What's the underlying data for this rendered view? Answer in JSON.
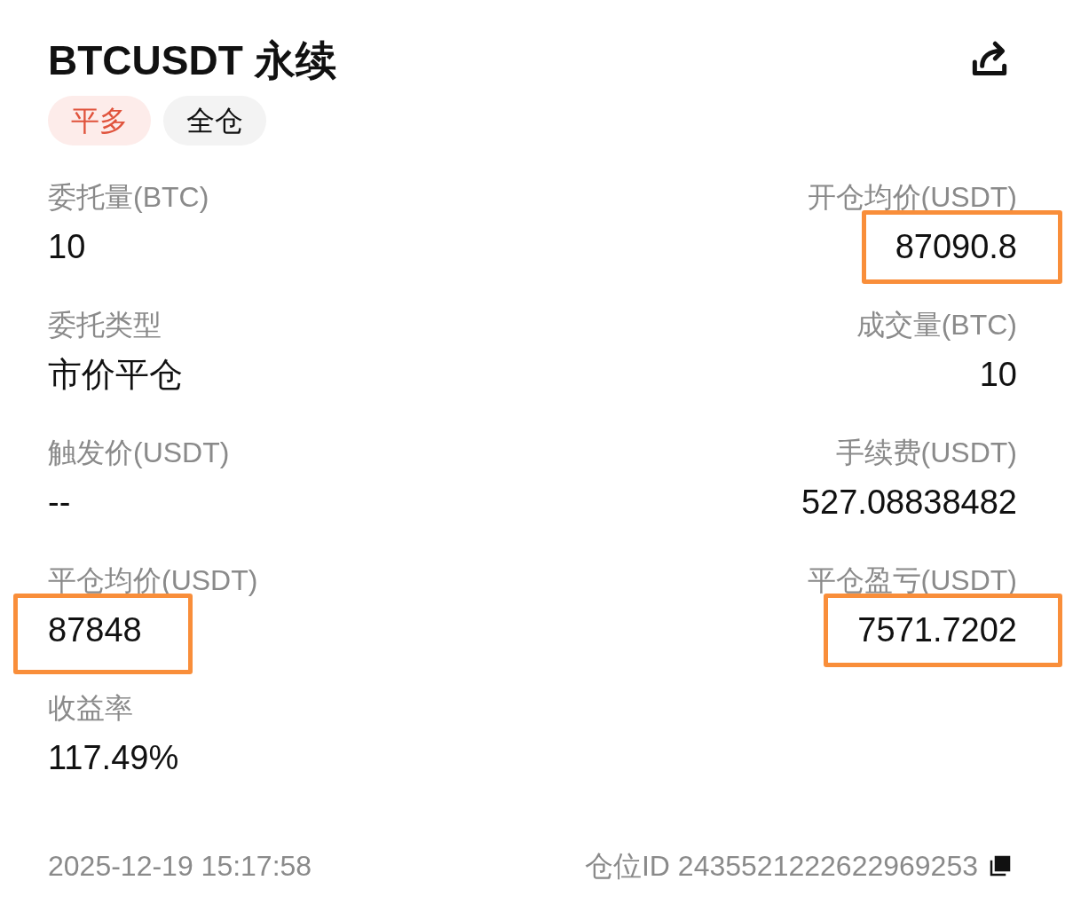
{
  "title": "BTCUSDT 永续",
  "tags": [
    {
      "label": "平多",
      "kind": "side"
    },
    {
      "label": "全仓",
      "kind": "mode"
    }
  ],
  "fields": [
    {
      "label": "委托量(BTC)",
      "value": "10",
      "highlighted": false
    },
    {
      "label": "开仓均价(USDT)",
      "value": "87090.8",
      "highlighted": true
    },
    {
      "label": "委托类型",
      "value": "市价平仓",
      "highlighted": false
    },
    {
      "label": "成交量(BTC)",
      "value": "10",
      "highlighted": false
    },
    {
      "label": "触发价(USDT)",
      "value": "--",
      "highlighted": false
    },
    {
      "label": "手续费(USDT)",
      "value": "527.08838482",
      "highlighted": false
    },
    {
      "label": "平仓均价(USDT)",
      "value": "87848",
      "highlighted": true
    },
    {
      "label": "平仓盈亏(USDT)",
      "value": "7571.7202",
      "highlighted": true
    },
    {
      "label": "收益率",
      "value": "117.49%",
      "highlighted": false
    }
  ],
  "footer": {
    "time": "2025-12-19 15:17:58",
    "position_id": "仓位ID 2435521222622969253"
  }
}
